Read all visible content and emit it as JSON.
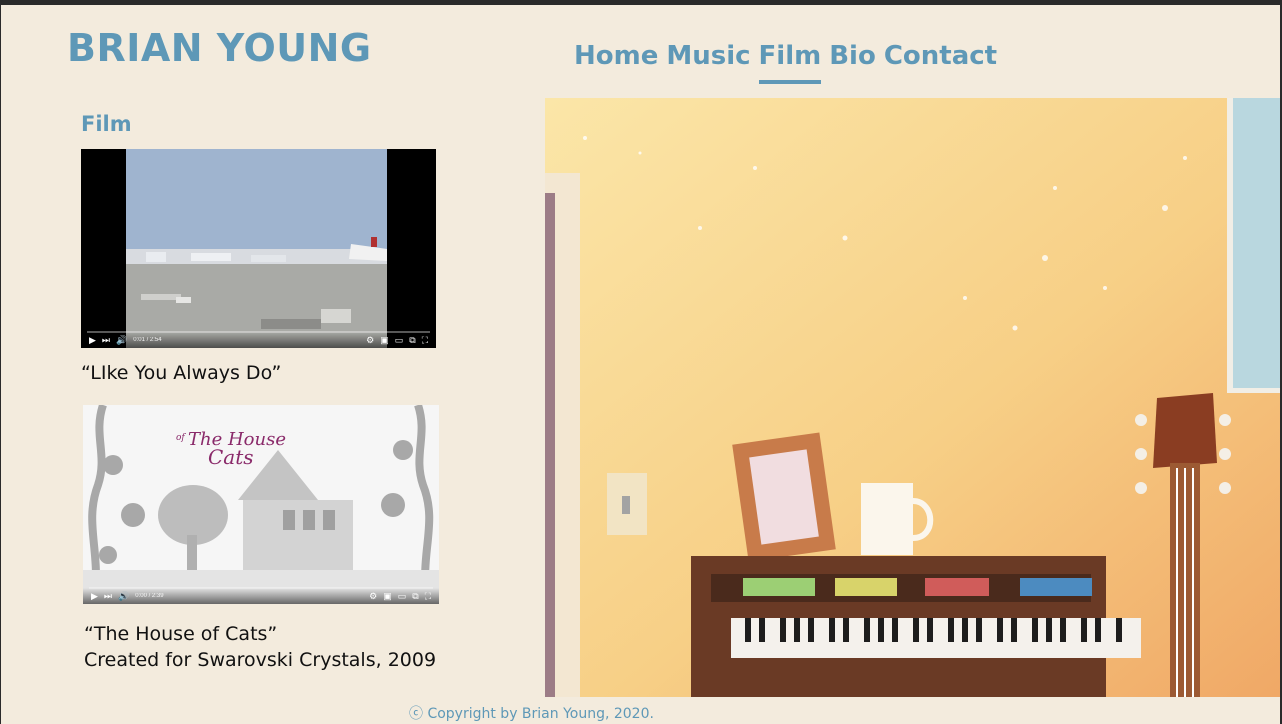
{
  "site": {
    "title": "BRIAN YOUNG"
  },
  "nav": {
    "items": [
      {
        "label": "Home",
        "active": false
      },
      {
        "label": "Music",
        "active": false
      },
      {
        "label": "Film",
        "active": true
      },
      {
        "label": "Bio",
        "active": false
      },
      {
        "label": "Contact",
        "active": false
      }
    ]
  },
  "section": {
    "heading": "Film"
  },
  "videos": [
    {
      "caption": "“LIke You Always Do”",
      "time": "0:01 / 2:54"
    },
    {
      "thumb_title_small": "of",
      "thumb_title_line1": "The House",
      "thumb_title_line2": "Cats",
      "caption": "“The House of Cats”",
      "caption_line2": "Created for Swarovski Crystals, 2009",
      "time": "0:00 / 2:39"
    }
  ],
  "footer": {
    "text": "ⓒ Copyright by Brian Young, 2020."
  },
  "colors": {
    "accent": "#5e98b7",
    "background": "#f3ebdd"
  },
  "icons": [
    "play-icon",
    "next-icon",
    "volume-icon",
    "settings-icon",
    "miniplayer-icon",
    "theater-icon",
    "cast-icon",
    "fullscreen-icon"
  ]
}
